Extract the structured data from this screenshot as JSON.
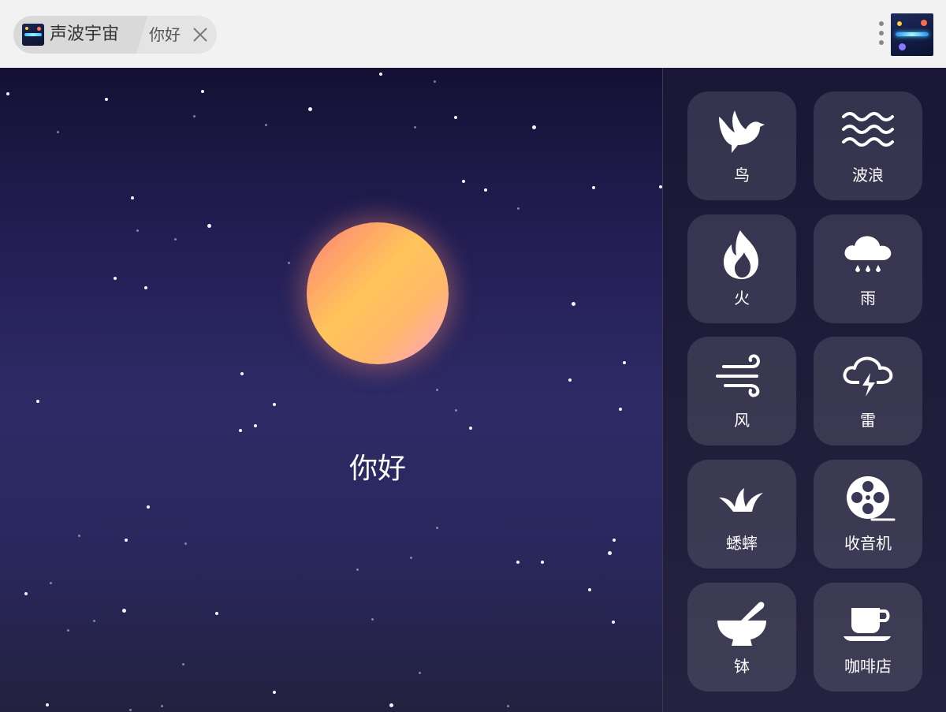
{
  "window": {
    "app_name": "声波宇宙",
    "tab_title": "你好"
  },
  "scene": {
    "text": "你好"
  },
  "sounds": [
    {
      "label": "鸟",
      "icon": "bird-icon"
    },
    {
      "label": "波浪",
      "icon": "waves-icon"
    },
    {
      "label": "火",
      "icon": "fire-icon"
    },
    {
      "label": "雨",
      "icon": "rain-cloud-icon"
    },
    {
      "label": "风",
      "icon": "wind-icon"
    },
    {
      "label": "雷",
      "icon": "thunder-cloud-icon"
    },
    {
      "label": "蟋蟀",
      "icon": "grass-icon"
    },
    {
      "label": "收音机",
      "icon": "film-reel-icon"
    },
    {
      "label": "钵",
      "icon": "mortar-pestle-icon"
    },
    {
      "label": "咖啡店",
      "icon": "coffee-cup-icon"
    }
  ],
  "colors": {
    "sky_top": "#141033",
    "sky_mid": "#2e2a66",
    "sun_warm": "#ffc55a",
    "sun_pink": "#ff9fd0",
    "tile_bg": "rgba(255,255,255,0.12)"
  }
}
